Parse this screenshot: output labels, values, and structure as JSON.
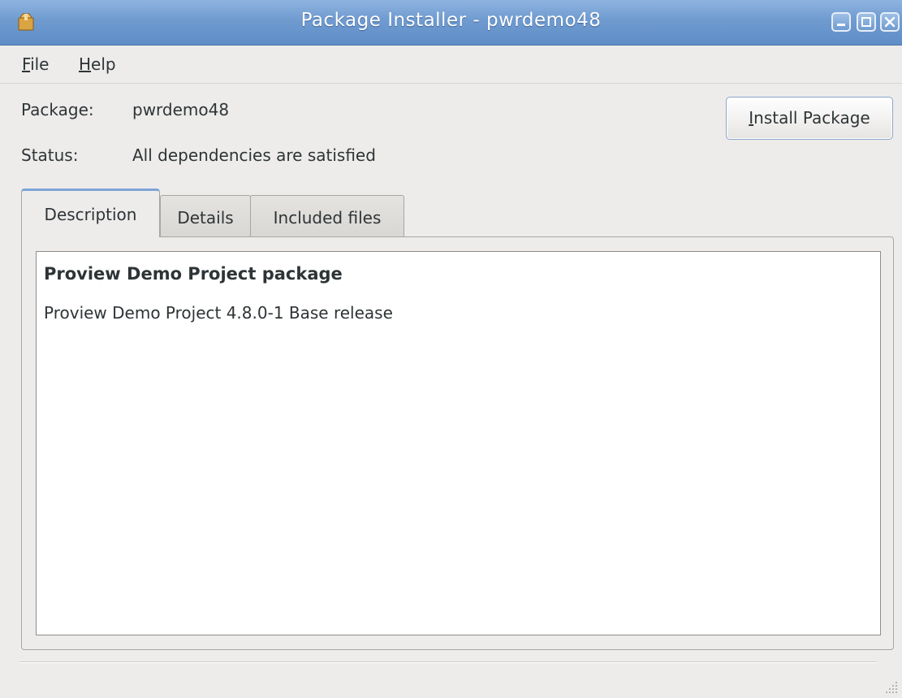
{
  "window": {
    "title": "Package Installer - pwrdemo48",
    "icon": "package-icon"
  },
  "menubar": {
    "file_label": "File",
    "file_mnemonic": "F",
    "file_rest": "ile",
    "help_label": "Help",
    "help_mnemonic": "H",
    "help_rest": "elp"
  },
  "package": {
    "label": "Package:",
    "value": "pwrdemo48"
  },
  "status": {
    "label": "Status:",
    "value": "All dependencies are satisfied"
  },
  "install_button": {
    "label": "Install Package",
    "mnemonic": "I",
    "rest": "nstall Package"
  },
  "tabs": [
    {
      "label": "Description",
      "active": true
    },
    {
      "label": "Details",
      "active": false
    },
    {
      "label": "Included files",
      "active": false
    }
  ],
  "description": {
    "title": "Proview Demo Project package",
    "body": "Proview Demo Project 4.8.0-1 Base release"
  },
  "colors": {
    "titlebar": "#6f9bd0",
    "window_bg": "#edeceb",
    "tab_accent": "#7ea4d6"
  }
}
